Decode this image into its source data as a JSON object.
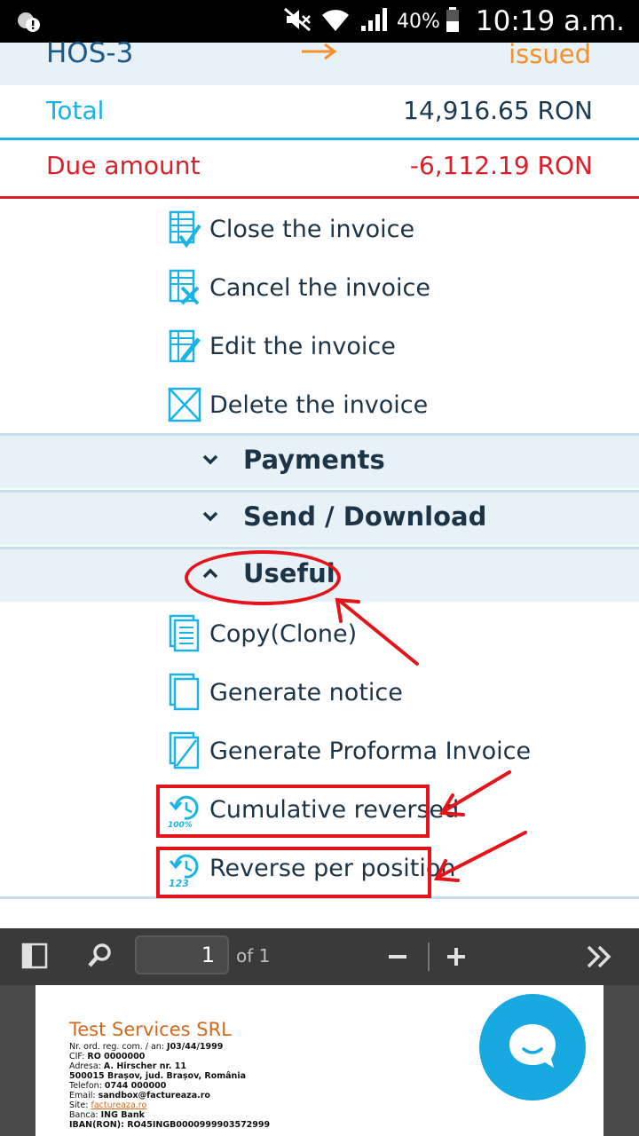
{
  "status_bar": {
    "battery": "40%",
    "time": "10:19 a.m."
  },
  "invoice": {
    "number": "HOS-3",
    "status": "issued",
    "total_label": "Total",
    "total_value": "14,916.65 RON",
    "due_label": "Due amount",
    "due_value": "-6,112.19 RON"
  },
  "actions": [
    {
      "label": "Close the invoice",
      "icon": "close-invoice-icon"
    },
    {
      "label": "Cancel the invoice",
      "icon": "cancel-invoice-icon"
    },
    {
      "label": "Edit the invoice",
      "icon": "edit-invoice-icon"
    },
    {
      "label": "Delete the invoice",
      "icon": "delete-invoice-icon"
    }
  ],
  "sections": {
    "payments": "Payments",
    "send_download": "Send / Download",
    "useful": "Useful"
  },
  "useful_items": [
    {
      "label": "Copy(Clone)",
      "icon": "copy-icon"
    },
    {
      "label": "Generate notice",
      "icon": "notice-icon"
    },
    {
      "label": "Generate Proforma Invoice",
      "icon": "proforma-icon"
    },
    {
      "label": "Cumulative reversed",
      "icon": "reverse-100-icon",
      "icon_text": "100%"
    },
    {
      "label": "Reverse per position",
      "icon": "reverse-123-icon",
      "icon_text": "123"
    }
  ],
  "pdf_viewer": {
    "page": "1",
    "of_label": "of 1"
  },
  "pdf_document": {
    "company": "Test Services SRL",
    "lines": [
      {
        "label": "Nr. ord. reg. com. / an: ",
        "value": "J03/44/1999"
      },
      {
        "label": "CIF: ",
        "value": "RO 0000000"
      },
      {
        "label": "Adresa: ",
        "value": "A. Hirscher nr. 11"
      },
      {
        "label": "",
        "value": "500015 Brașov, jud. Brașov, România"
      },
      {
        "label": "Telefon: ",
        "value": "0744 000000"
      },
      {
        "label": "Email: ",
        "value": "sandbox@factureaza.ro"
      },
      {
        "label": "Site: ",
        "value": "factureaza.ro"
      },
      {
        "label": "Banca: ",
        "value": "ING Bank"
      },
      {
        "label": "IBAN(RON): ",
        "value": "RO45INGB0000999903572999"
      }
    ]
  },
  "colors": {
    "accent_blue": "#1ab3e6",
    "due_red": "#d9202a",
    "status_orange": "#f5902a",
    "annotation_red": "#e4141a"
  }
}
